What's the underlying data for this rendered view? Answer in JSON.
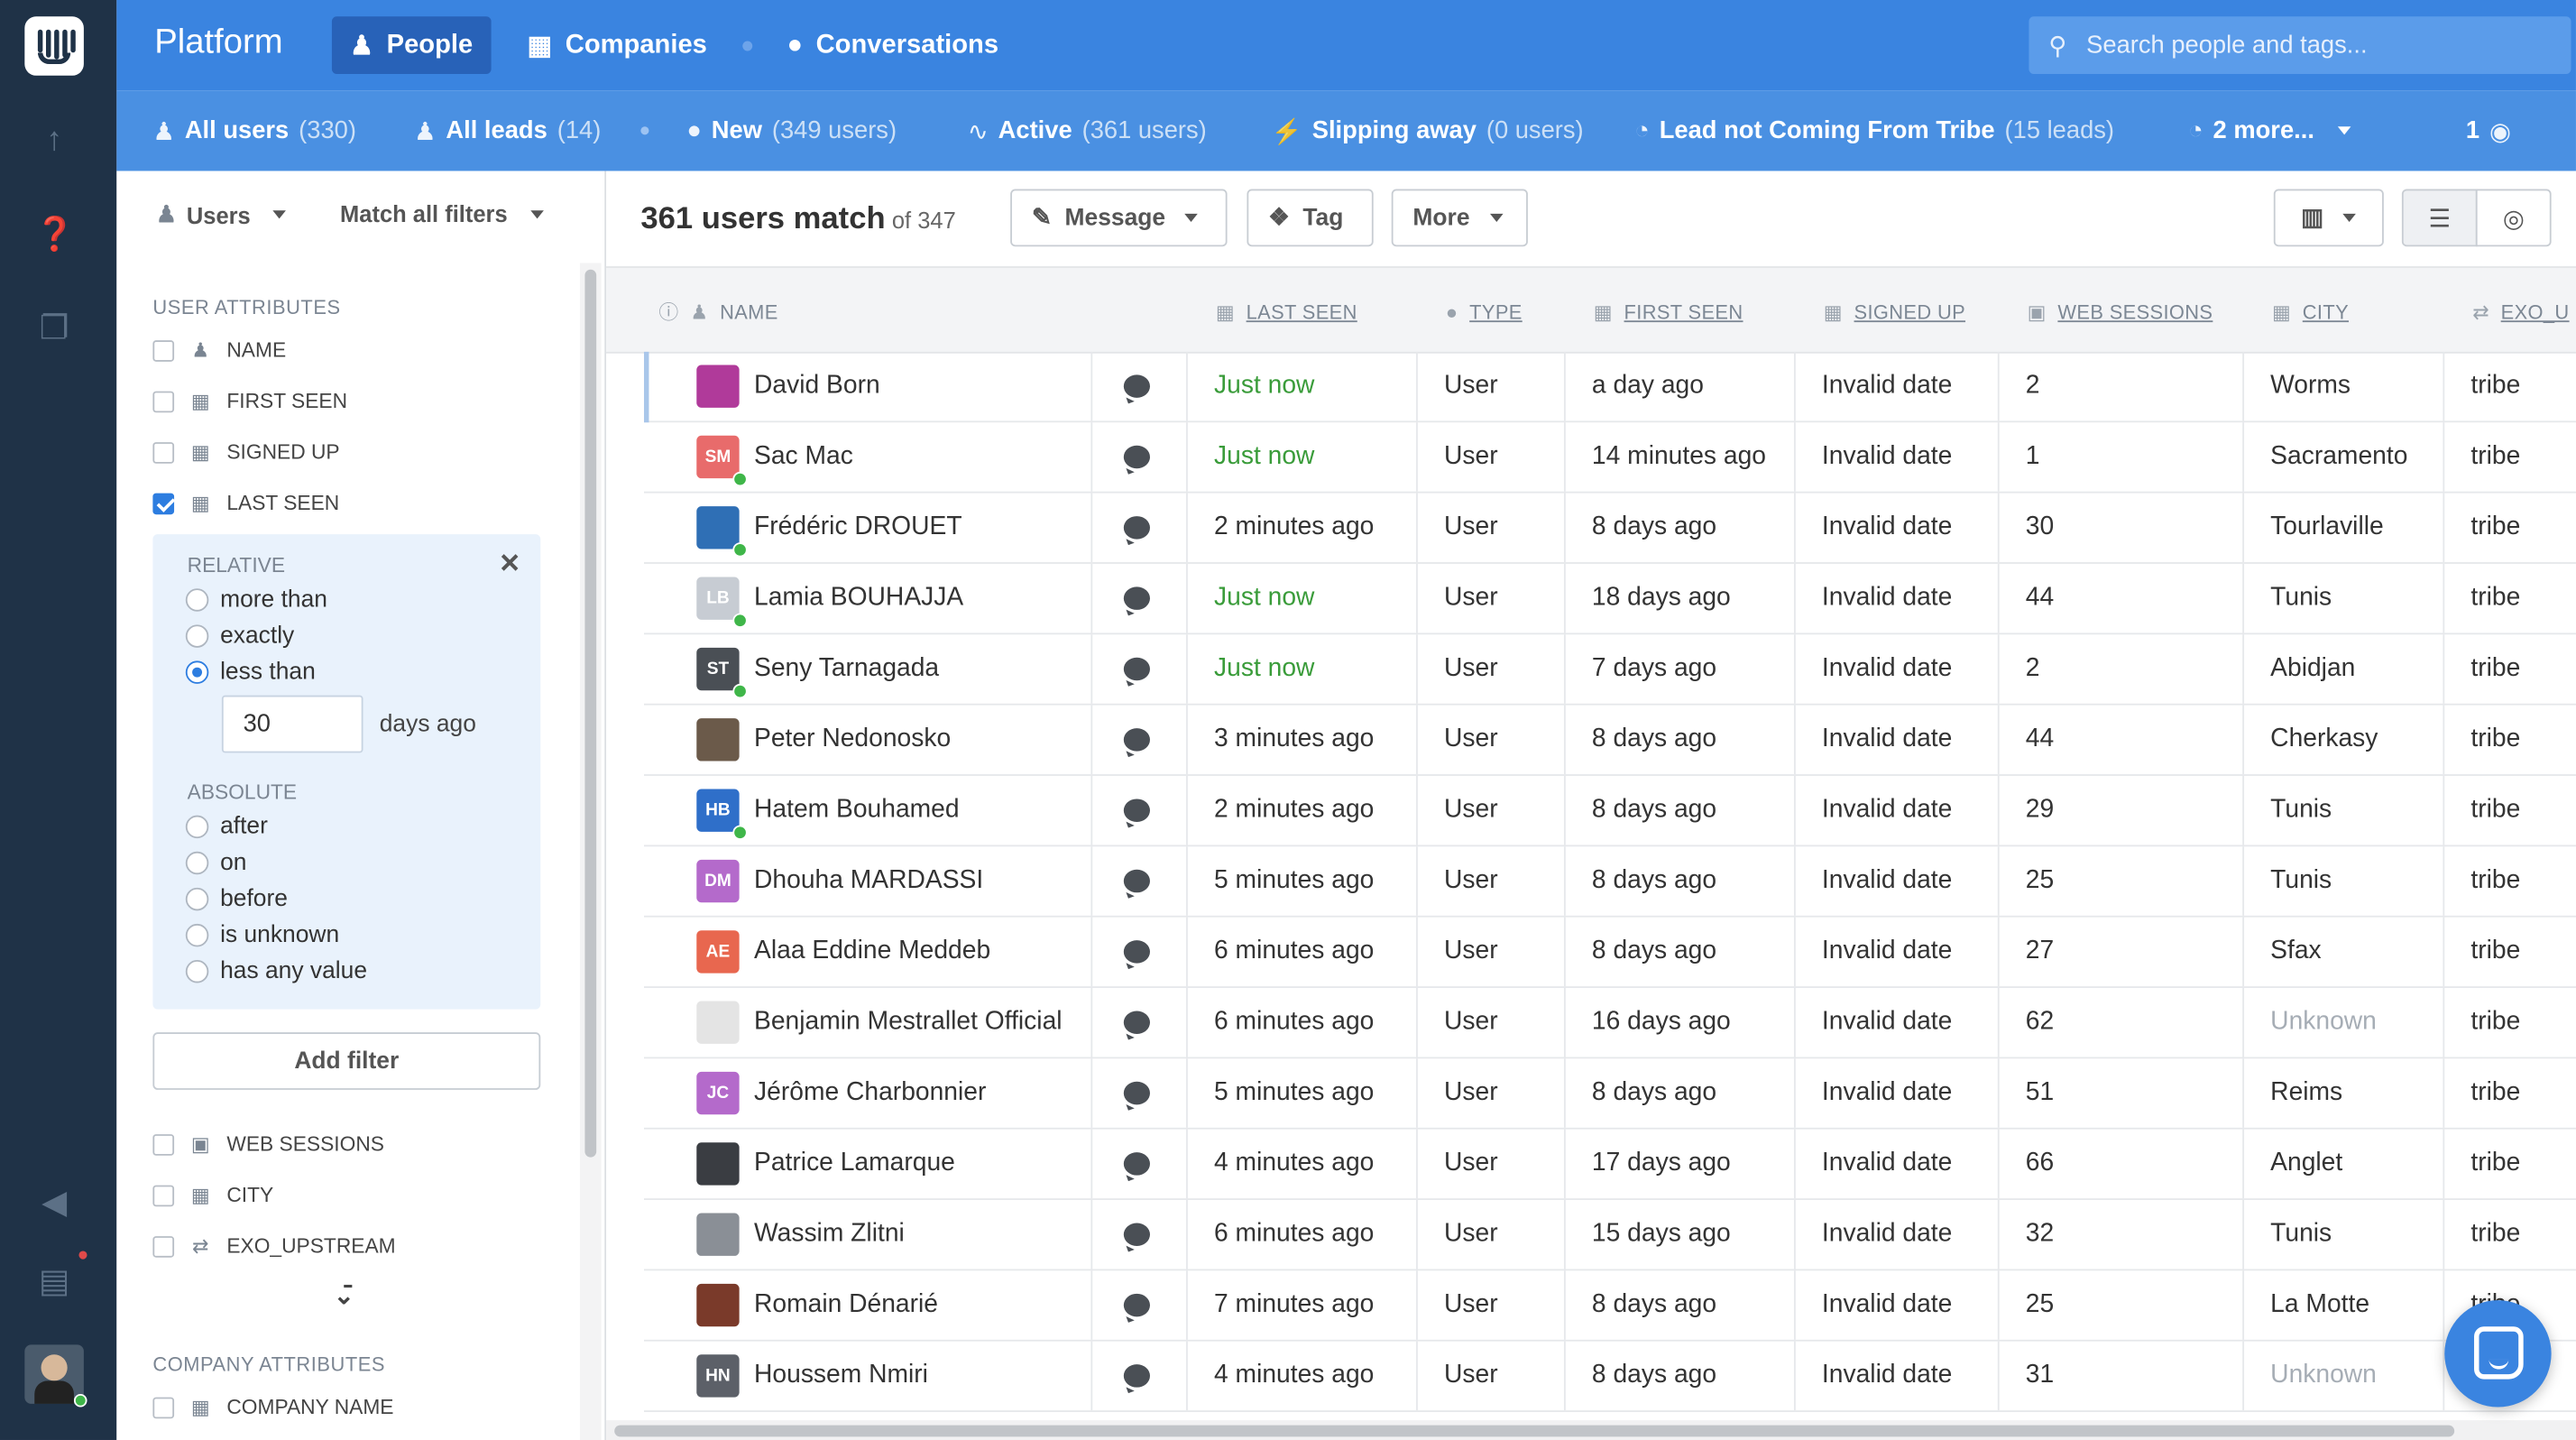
{
  "app": {
    "brand": "Platform"
  },
  "nav": {
    "tabs": [
      {
        "label": "People",
        "icon": "people-icon",
        "active": true
      },
      {
        "label": "Companies",
        "icon": "building-icon"
      },
      {
        "label": "Conversations",
        "icon": "chat-bubble-icon"
      }
    ],
    "search_placeholder": "Search people and tags..."
  },
  "segments": [
    {
      "name": "All users",
      "count": "(330)",
      "icon": "people-icon"
    },
    {
      "name": "All leads",
      "count": "(14)",
      "icon": "people-icon"
    },
    {
      "name": "New",
      "count": "(349 users)",
      "icon": "person-icon"
    },
    {
      "name": "Active",
      "count": "(361 users)",
      "icon": "pulse-icon",
      "active": true
    },
    {
      "name": "Slipping away",
      "count": "(0 users)",
      "icon": "lightning-icon"
    },
    {
      "name": "Lead not Coming From Tribe",
      "count": "(15 leads)",
      "icon": "pie-chart-icon"
    },
    {
      "name": "2 more...",
      "count": "",
      "icon": "pie-chart-icon"
    }
  ],
  "watchers": "1",
  "filters": {
    "users_dropdown": "Users",
    "match_dropdown": "Match all filters",
    "user_attributes_title": "USER ATTRIBUTES",
    "user_attributes": [
      {
        "label": "NAME",
        "checked": false,
        "icon": "people-icon"
      },
      {
        "label": "FIRST SEEN",
        "checked": false,
        "icon": "calendar-icon"
      },
      {
        "label": "SIGNED UP",
        "checked": false,
        "icon": "calendar-icon"
      },
      {
        "label": "LAST SEEN",
        "checked": true,
        "icon": "calendar-icon"
      }
    ],
    "relative_label": "RELATIVE",
    "relative_options": [
      "more than",
      "exactly",
      "less than"
    ],
    "relative_selected": "less than",
    "value": "30",
    "unit": "days ago",
    "absolute_label": "ABSOLUTE",
    "absolute_options": [
      "after",
      "on",
      "before",
      "is unknown",
      "has any value"
    ],
    "add_filter": "Add filter",
    "more_attributes": [
      {
        "label": "WEB SESSIONS",
        "icon": "chart-icon"
      },
      {
        "label": "CITY",
        "icon": "building-icon"
      },
      {
        "label": "EXO_UPSTREAM",
        "icon": "arrows-icon"
      }
    ],
    "company_attributes_title": "COMPANY ATTRIBUTES",
    "company_attributes": [
      {
        "label": "COMPANY NAME",
        "icon": "building-icon"
      }
    ]
  },
  "main": {
    "count_title": "361 users match",
    "count_sub": "of 347",
    "buttons": {
      "message": "Message",
      "tag": "Tag",
      "more": "More"
    }
  },
  "table": {
    "columns": [
      "NAME",
      "LAST SEEN",
      "TYPE",
      "FIRST SEEN",
      "SIGNED UP",
      "WEB SESSIONS",
      "CITY",
      "EXO_U"
    ],
    "rows": [
      {
        "name": "David Born",
        "initials": "",
        "avatar_color": "#b03a9a",
        "online": false,
        "last_seen": "Just now",
        "recent": true,
        "type": "User",
        "first_seen": "a day ago",
        "signed_up": "Invalid date",
        "sessions": "2",
        "city": "Worms",
        "exo": "tribe"
      },
      {
        "name": "Sac Mac",
        "initials": "SM",
        "avatar_color": "#e86b6b",
        "online": true,
        "last_seen": "Just now",
        "recent": true,
        "type": "User",
        "first_seen": "14 minutes ago",
        "signed_up": "Invalid date",
        "sessions": "1",
        "city": "Sacramento",
        "exo": "tribe"
      },
      {
        "name": "Frédéric DROUET",
        "initials": "",
        "avatar_color": "#2f6fb5",
        "online": true,
        "last_seen": "2 minutes ago",
        "recent": false,
        "type": "User",
        "first_seen": "8 days ago",
        "signed_up": "Invalid date",
        "sessions": "30",
        "city": "Tourlaville",
        "exo": "tribe"
      },
      {
        "name": "Lamia BOUHAJJA",
        "initials": "LB",
        "avatar_color": "#c7ccd3",
        "online": true,
        "last_seen": "Just now",
        "recent": true,
        "type": "User",
        "first_seen": "18 days ago",
        "signed_up": "Invalid date",
        "sessions": "44",
        "city": "Tunis",
        "exo": "tribe"
      },
      {
        "name": "Seny Tarnagada",
        "initials": "ST",
        "avatar_color": "#4a4f55",
        "online": true,
        "last_seen": "Just now",
        "recent": true,
        "type": "User",
        "first_seen": "7 days ago",
        "signed_up": "Invalid date",
        "sessions": "2",
        "city": "Abidjan",
        "exo": "tribe"
      },
      {
        "name": "Peter Nedonosko",
        "initials": "",
        "avatar_color": "#6b5a4a",
        "online": false,
        "last_seen": "3 minutes ago",
        "recent": false,
        "type": "User",
        "first_seen": "8 days ago",
        "signed_up": "Invalid date",
        "sessions": "44",
        "city": "Cherkasy",
        "exo": "tribe"
      },
      {
        "name": "Hatem Bouhamed",
        "initials": "HB",
        "avatar_color": "#2f6fc9",
        "online": true,
        "last_seen": "2 minutes ago",
        "recent": false,
        "type": "User",
        "first_seen": "8 days ago",
        "signed_up": "Invalid date",
        "sessions": "29",
        "city": "Tunis",
        "exo": "tribe"
      },
      {
        "name": "Dhouha MARDASSI",
        "initials": "DM",
        "avatar_color": "#b46acb",
        "online": false,
        "last_seen": "5 minutes ago",
        "recent": false,
        "type": "User",
        "first_seen": "8 days ago",
        "signed_up": "Invalid date",
        "sessions": "25",
        "city": "Tunis",
        "exo": "tribe"
      },
      {
        "name": "Alaa Eddine Meddeb",
        "initials": "AE",
        "avatar_color": "#e8674f",
        "online": false,
        "last_seen": "6 minutes ago",
        "recent": false,
        "type": "User",
        "first_seen": "8 days ago",
        "signed_up": "Invalid date",
        "sessions": "27",
        "city": "Sfax",
        "exo": "tribe"
      },
      {
        "name": "Benjamin Mestrallet Official",
        "initials": "",
        "avatar_color": "#e4e4e4",
        "online": false,
        "last_seen": "6 minutes ago",
        "recent": false,
        "type": "User",
        "first_seen": "16 days ago",
        "signed_up": "Invalid date",
        "sessions": "62",
        "city": "Unknown",
        "city_unknown": true,
        "exo": "tribe"
      },
      {
        "name": "Jérôme Charbonnier",
        "initials": "JC",
        "avatar_color": "#b46acb",
        "online": false,
        "last_seen": "5 minutes ago",
        "recent": false,
        "type": "User",
        "first_seen": "8 days ago",
        "signed_up": "Invalid date",
        "sessions": "51",
        "city": "Reims",
        "exo": "tribe"
      },
      {
        "name": "Patrice Lamarque",
        "initials": "",
        "avatar_color": "#3a3d42",
        "online": false,
        "last_seen": "4 minutes ago",
        "recent": false,
        "type": "User",
        "first_seen": "17 days ago",
        "signed_up": "Invalid date",
        "sessions": "66",
        "city": "Anglet",
        "exo": "tribe"
      },
      {
        "name": "Wassim Zlitni",
        "initials": "",
        "avatar_color": "#8a8f96",
        "online": false,
        "last_seen": "6 minutes ago",
        "recent": false,
        "type": "User",
        "first_seen": "15 days ago",
        "signed_up": "Invalid date",
        "sessions": "32",
        "city": "Tunis",
        "exo": "tribe"
      },
      {
        "name": "Romain Dénarié",
        "initials": "",
        "avatar_color": "#7a3a2a",
        "online": false,
        "last_seen": "7 minutes ago",
        "recent": false,
        "type": "User",
        "first_seen": "8 days ago",
        "signed_up": "Invalid date",
        "sessions": "25",
        "city": "La Motte",
        "exo": "tribe"
      },
      {
        "name": "Houssem Nmiri",
        "initials": "HN",
        "avatar_color": "#5c6068",
        "online": false,
        "last_seen": "4 minutes ago",
        "recent": false,
        "type": "User",
        "first_seen": "8 days ago",
        "signed_up": "Invalid date",
        "sessions": "31",
        "city": "Unknown",
        "city_unknown": true,
        "exo": "tribe"
      }
    ]
  },
  "colors": {
    "topbar": "#3a84e0",
    "segbar": "#4a90e2",
    "rail": "#1f3247",
    "recent_text": "#3a9c3a"
  }
}
